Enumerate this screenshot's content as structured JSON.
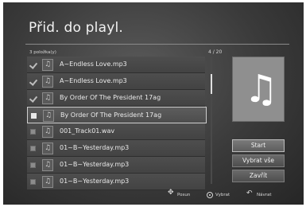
{
  "title": "Přid. do playl.",
  "item_count": "3 položka(y)",
  "pager": "4 / 20",
  "files": [
    {
      "name": "A~Endless Love.mp3",
      "checked": true,
      "selected": false
    },
    {
      "name": "A~Endless Love.mp3",
      "checked": true,
      "selected": false
    },
    {
      "name": "By Order Of The President 17ag",
      "checked": true,
      "selected": false
    },
    {
      "name": "By Order Of The President 17ag",
      "checked": false,
      "selected": true
    },
    {
      "name": "001_Track01.wav",
      "checked": false,
      "selected": false
    },
    {
      "name": "01~B~Yesterday.mp3",
      "checked": false,
      "selected": false
    },
    {
      "name": "01~B~Yesterday.mp3",
      "checked": false,
      "selected": false
    },
    {
      "name": "01~B~Yesterday.mp3",
      "checked": false,
      "selected": false
    }
  ],
  "buttons": {
    "start": "Start",
    "select_all": "Vybrat vše",
    "close": "Zavřít"
  },
  "hints": {
    "move": "Posun",
    "select": "Vybrat",
    "back": "Návrat"
  },
  "icons": {
    "file_icon": "music-note-icon",
    "preview_icon": "music-note-icon"
  }
}
